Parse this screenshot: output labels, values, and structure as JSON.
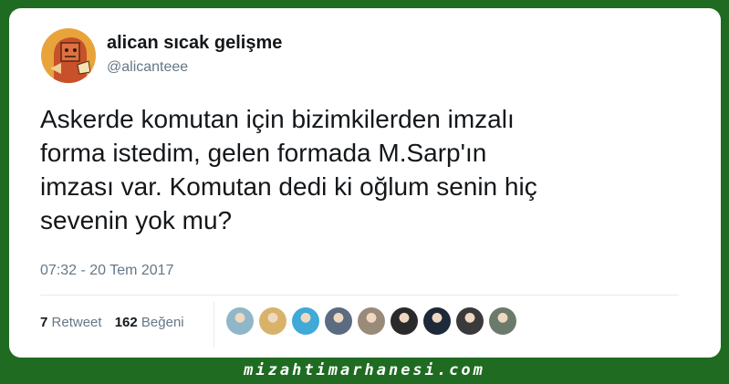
{
  "tweet": {
    "author": {
      "display_name": "alican sıcak gelişme",
      "handle": "@alicanteee",
      "avatar_icon": "cartoon-avatar-icon"
    },
    "text": "Askerde komutan için bizimkilerden imzalı\nforma istedim, gelen formada M.Sarp'ın\nimzası var. Komutan dedi ki oğlum senin hiç\nsevenin yok mu?",
    "timestamp": "07:32 - 20 Tem 2017",
    "retweets": {
      "count": "7",
      "label": "Retweet"
    },
    "likes": {
      "count": "162",
      "label": "Beğeni"
    },
    "liker_avatars": [
      {
        "icon": "liker-avatar-1",
        "color": "#8fb7c9"
      },
      {
        "icon": "liker-avatar-2",
        "color": "#d9b26a"
      },
      {
        "icon": "liker-avatar-3",
        "color": "#3fa9d8"
      },
      {
        "icon": "liker-avatar-4",
        "color": "#5b6b80"
      },
      {
        "icon": "liker-avatar-5",
        "color": "#9a8a7a"
      },
      {
        "icon": "liker-avatar-6",
        "color": "#2a2a2a"
      },
      {
        "icon": "liker-avatar-7",
        "color": "#1e2a3a"
      },
      {
        "icon": "liker-avatar-8",
        "color": "#3a3a3a"
      },
      {
        "icon": "liker-avatar-9",
        "color": "#6b7a6b"
      }
    ]
  },
  "watermark": "mizahtimarhanesi.com",
  "colors": {
    "background": "#1f6b22",
    "card": "#ffffff",
    "text": "#14171a",
    "muted": "#657786"
  }
}
